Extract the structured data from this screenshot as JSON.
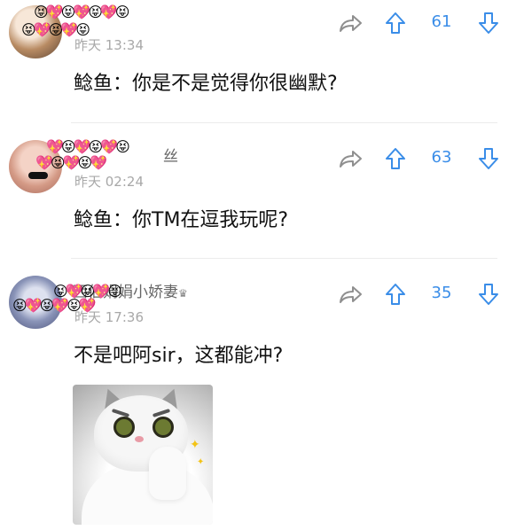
{
  "comments": [
    {
      "name_tail": "",
      "timestamp": "昨天 13:34",
      "text": "鲶鱼：你是不是觉得你很幽默?",
      "votes": "61",
      "emoji_row1": "😝💖😝💖😝💖😝",
      "emoji_row2": "😝💖😝💖😝"
    },
    {
      "name_tail": "丝",
      "timestamp": "昨天 02:24",
      "text": "鲶鱼：你TM在逗我玩呢?",
      "votes": "63",
      "emoji_row1": "💖😝💖😝💖😝",
      "emoji_row2": "💖😝💖😝💖"
    },
    {
      "name_tail": "西伯娟娟小娇妻",
      "timestamp": "昨天 17:36",
      "text": "不是吧阿sir，这都能冲?",
      "votes": "35",
      "emoji_row1": "😝💖😝💖😝",
      "emoji_row2": "😝💖😝💖😝💖"
    }
  ],
  "icons": {
    "share": "share-arrow-icon",
    "upvote": "arrow-up-icon",
    "downvote": "arrow-down-icon",
    "crown": "♛"
  },
  "colors": {
    "accent": "#3a8de8",
    "timestamp": "#a8a8a8"
  }
}
